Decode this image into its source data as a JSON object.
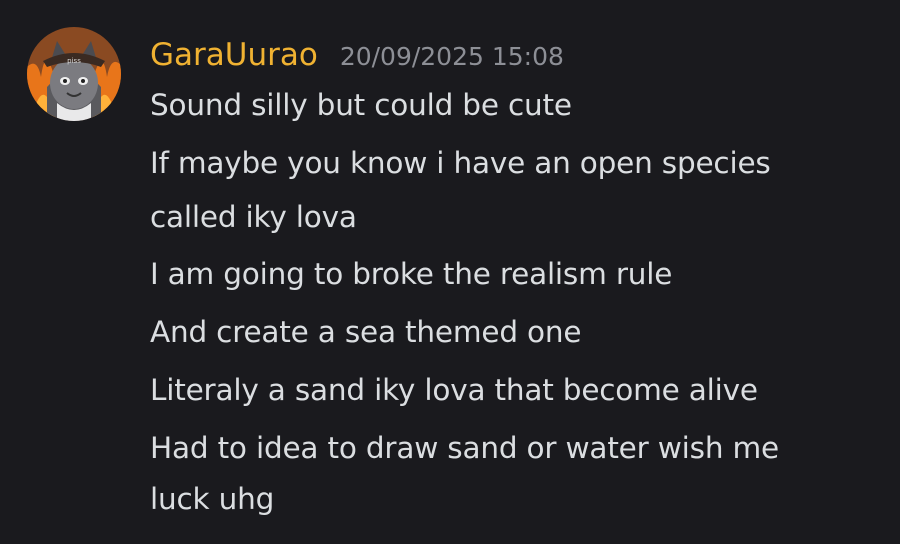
{
  "colors": {
    "background": "#1a1a1e",
    "username": "#f0b232",
    "message_text": "#dbdee1",
    "timestamp": "#8d8f96"
  },
  "message": {
    "avatar_icon": "cat-avatar-icon",
    "avatar_badge_text": "piss",
    "username": "GaraUurao",
    "timestamp": "20/09/2025 15:08",
    "lines": [
      "Sound silly but could be cute",
      "If maybe you know i have an open species",
      "called iky lova",
      "I am going to broke the realism rule",
      "And create a sea themed one",
      "Literaly a sand iky lova that become alive",
      "Had to idea to draw sand or water wish me",
      "luck uhg"
    ]
  }
}
